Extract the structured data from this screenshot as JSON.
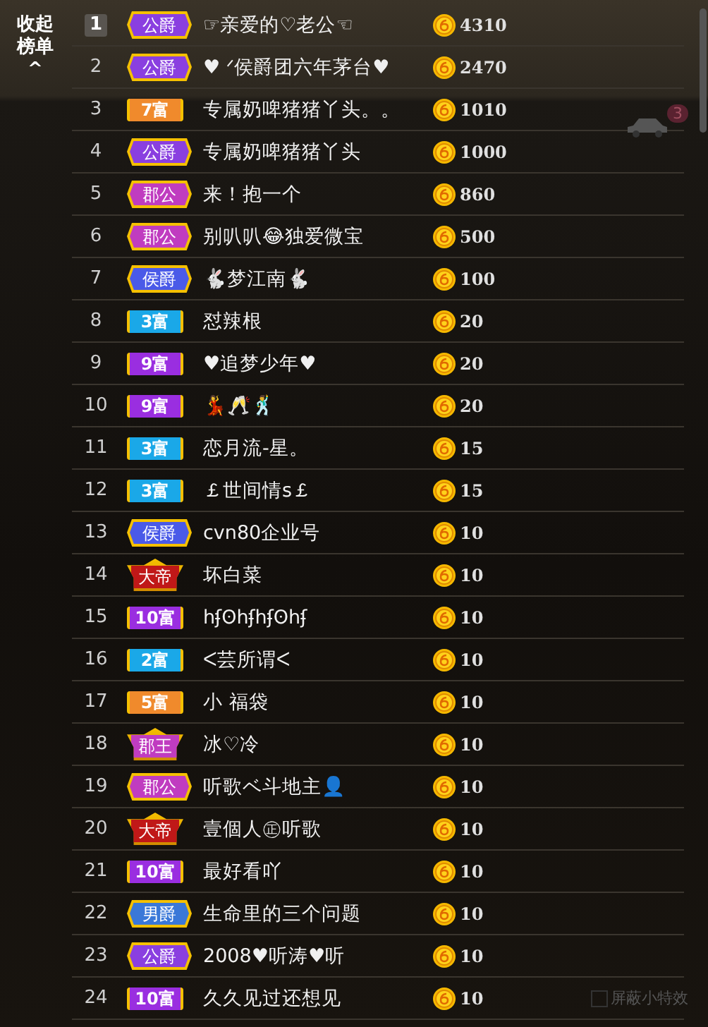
{
  "collapse": {
    "label": "收起榜单",
    "arrow": "^"
  },
  "rows": [
    {
      "rank": "1",
      "rank_boxed": true,
      "badge": {
        "text": "公爵",
        "kind": "hex",
        "color": "#8a3fe0"
      },
      "name": "☞亲爱的♡老公☜",
      "amount": "4310"
    },
    {
      "rank": "2",
      "rank_boxed": false,
      "badge": {
        "text": "公爵",
        "kind": "hex",
        "color": "#8a3fe0"
      },
      "name": "♥ ᐟ侯爵团六年茅台♥",
      "amount": "2470"
    },
    {
      "rank": "3",
      "rank_boxed": false,
      "badge": {
        "text": "7富",
        "kind": "bar",
        "color": "#f08a2c"
      },
      "name": "专属奶啤猪猪丫头。。",
      "amount": "1010"
    },
    {
      "rank": "4",
      "rank_boxed": false,
      "badge": {
        "text": "公爵",
        "kind": "hex",
        "color": "#8a3fe0"
      },
      "name": "专属奶啤猪猪丫头",
      "amount": "1000"
    },
    {
      "rank": "5",
      "rank_boxed": false,
      "badge": {
        "text": "郡公",
        "kind": "hex",
        "color": "#c03cc0"
      },
      "name": "来！抱一个",
      "amount": "860"
    },
    {
      "rank": "6",
      "rank_boxed": false,
      "badge": {
        "text": "郡公",
        "kind": "hex",
        "color": "#c03cc0"
      },
      "name": "别叭叭😂独爱微宝",
      "amount": "500"
    },
    {
      "rank": "7",
      "rank_boxed": false,
      "badge": {
        "text": "侯爵",
        "kind": "hex",
        "color": "#4a5ae8"
      },
      "name": "🐇梦江南🐇",
      "amount": "100"
    },
    {
      "rank": "8",
      "rank_boxed": false,
      "badge": {
        "text": "3富",
        "kind": "bar",
        "color": "#1aa8e8"
      },
      "name": "怼辣根",
      "amount": "20"
    },
    {
      "rank": "9",
      "rank_boxed": false,
      "badge": {
        "text": "9富",
        "kind": "bar",
        "color": "#9a2ee0"
      },
      "name": "♥追梦少年♥",
      "amount": "20"
    },
    {
      "rank": "10",
      "rank_boxed": false,
      "badge": {
        "text": "9富",
        "kind": "bar",
        "color": "#9a2ee0"
      },
      "name": "💃🥂🕺",
      "amount": "20"
    },
    {
      "rank": "11",
      "rank_boxed": false,
      "badge": {
        "text": "3富",
        "kind": "bar",
        "color": "#1aa8e8"
      },
      "name": "恋月流-星。",
      "amount": "15"
    },
    {
      "rank": "12",
      "rank_boxed": false,
      "badge": {
        "text": "3富",
        "kind": "bar",
        "color": "#1aa8e8"
      },
      "name": "￡世间情s￡",
      "amount": "15"
    },
    {
      "rank": "13",
      "rank_boxed": false,
      "badge": {
        "text": "侯爵",
        "kind": "hex",
        "color": "#4a5ae8"
      },
      "name": "cvn80企业号",
      "amount": "10"
    },
    {
      "rank": "14",
      "rank_boxed": false,
      "badge": {
        "text": "大帝",
        "kind": "crown",
        "color": "#c01818"
      },
      "name": "坏白菜",
      "amount": "10"
    },
    {
      "rank": "15",
      "rank_boxed": false,
      "badge": {
        "text": "10富",
        "kind": "bar",
        "color": "#9a2ee0"
      },
      "name": "hʄʘhʄhʄʘhʄ",
      "amount": "10"
    },
    {
      "rank": "16",
      "rank_boxed": false,
      "badge": {
        "text": "2富",
        "kind": "bar",
        "color": "#1aa8e8"
      },
      "name": "ᐸ芸所谓ᐸ",
      "amount": "10"
    },
    {
      "rank": "17",
      "rank_boxed": false,
      "badge": {
        "text": "5富",
        "kind": "bar",
        "color": "#f08a2c"
      },
      "name": "小 福袋",
      "amount": "10"
    },
    {
      "rank": "18",
      "rank_boxed": false,
      "badge": {
        "text": "郡王",
        "kind": "crown",
        "color": "#c03cc0"
      },
      "name": "冰♡冷",
      "amount": "10"
    },
    {
      "rank": "19",
      "rank_boxed": false,
      "badge": {
        "text": "郡公",
        "kind": "hex",
        "color": "#c03cc0"
      },
      "name": "听歌ベ斗地主👤",
      "amount": "10"
    },
    {
      "rank": "20",
      "rank_boxed": false,
      "badge": {
        "text": "大帝",
        "kind": "crown",
        "color": "#c01818"
      },
      "name": "壹個人㊣听歌",
      "amount": "10"
    },
    {
      "rank": "21",
      "rank_boxed": false,
      "badge": {
        "text": "10富",
        "kind": "bar",
        "color": "#9a2ee0"
      },
      "name": "最好看吖",
      "amount": "10"
    },
    {
      "rank": "22",
      "rank_boxed": false,
      "badge": {
        "text": "男爵",
        "kind": "hex",
        "color": "#3a78d8"
      },
      "name": "生命里的三个问题",
      "amount": "10"
    },
    {
      "rank": "23",
      "rank_boxed": false,
      "badge": {
        "text": "公爵",
        "kind": "hex",
        "color": "#8a3fe0"
      },
      "name": "2008♥听涛♥听",
      "amount": "10"
    },
    {
      "rank": "24",
      "rank_boxed": false,
      "badge": {
        "text": "10富",
        "kind": "bar",
        "color": "#9a2ee0"
      },
      "name": "久久见过还想见",
      "amount": "10"
    }
  ],
  "car_badge": "3",
  "effects_toggle": {
    "label": "屏蔽小特效",
    "checked": false
  }
}
